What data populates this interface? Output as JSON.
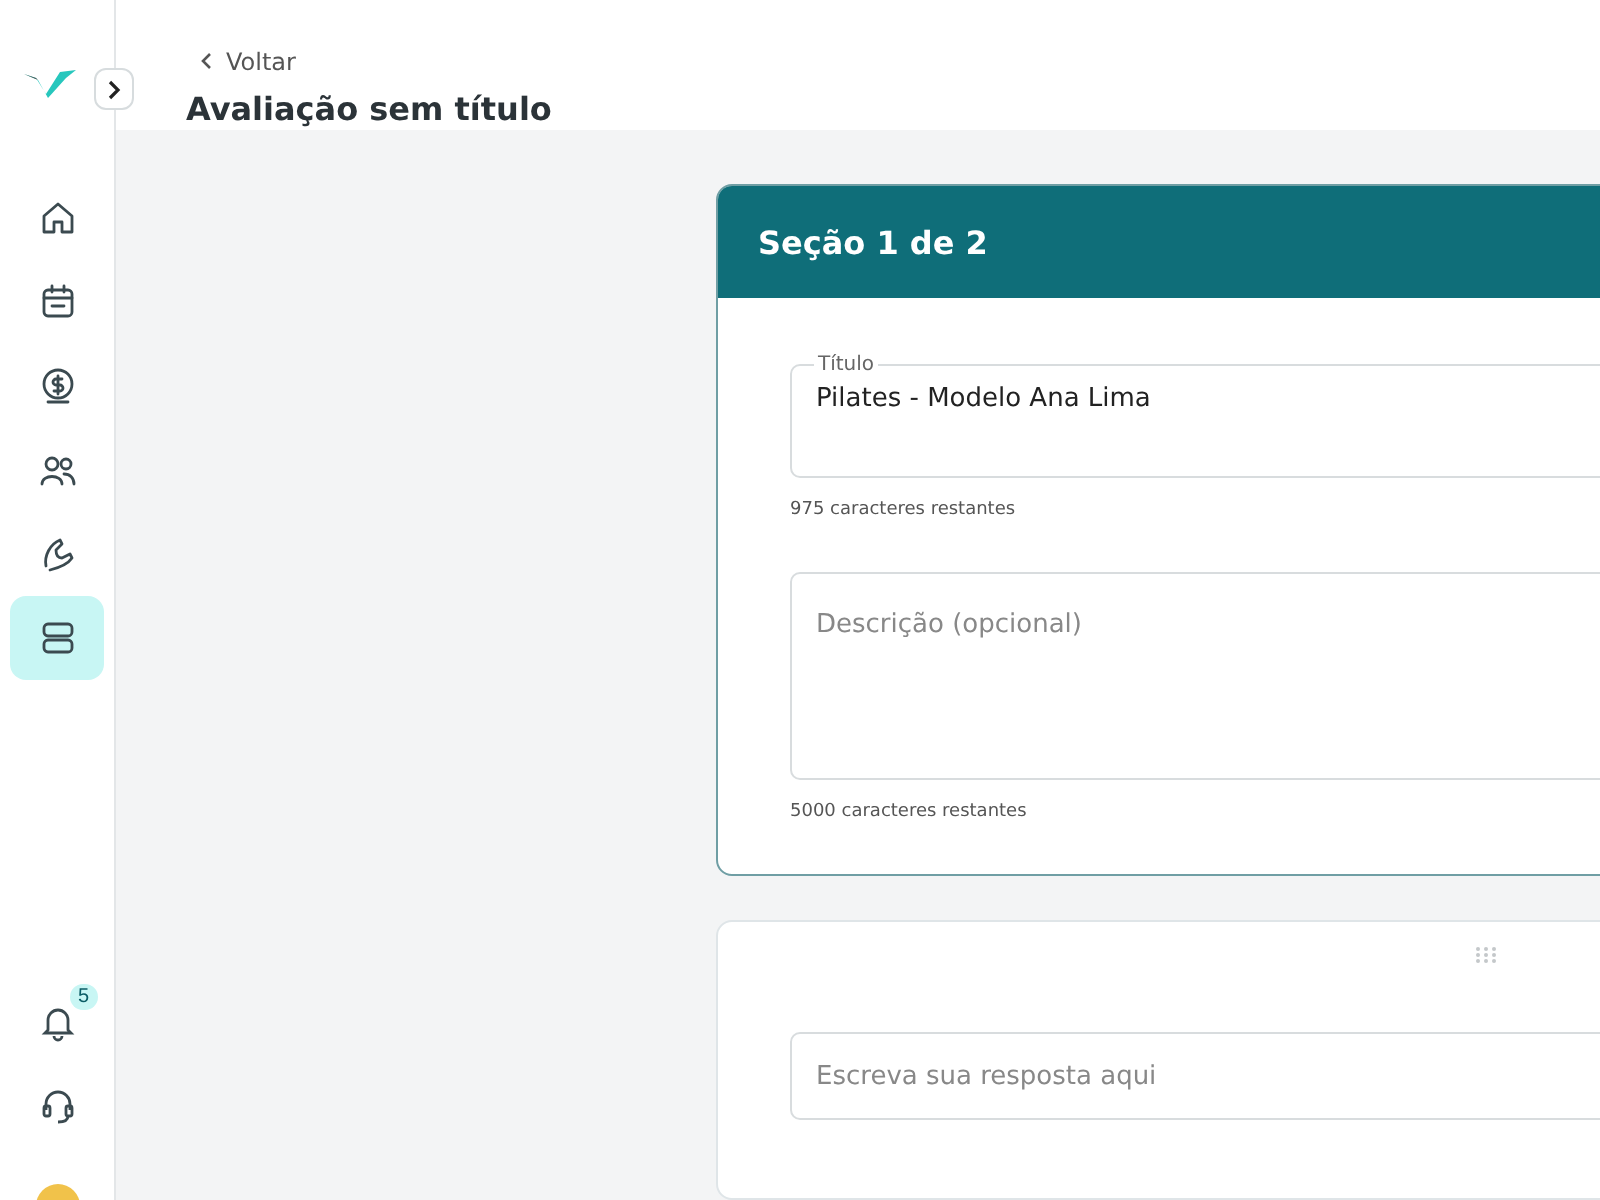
{
  "header": {
    "back_link": "Voltar",
    "title": "Avaliação sem título"
  },
  "sidebar": {
    "items": [
      {
        "kind": "home",
        "selected": false
      },
      {
        "kind": "calendar",
        "selected": false
      },
      {
        "kind": "money",
        "selected": false
      },
      {
        "kind": "people",
        "selected": false
      },
      {
        "kind": "arm",
        "selected": false
      },
      {
        "kind": "layers",
        "selected": true
      }
    ],
    "notifications": {
      "badge": "5"
    }
  },
  "section": {
    "heading": "Seção 1 de 2",
    "title_field": {
      "label": "Título",
      "value": "Pilates - Modelo Ana Lima",
      "counter": "975 caracteres restantes"
    },
    "description_field": {
      "placeholder": "Descrição (opcional)",
      "counter": "5000 caracteres restantes"
    }
  },
  "question": {
    "answer_placeholder": "Escreva sua resposta aqui"
  }
}
